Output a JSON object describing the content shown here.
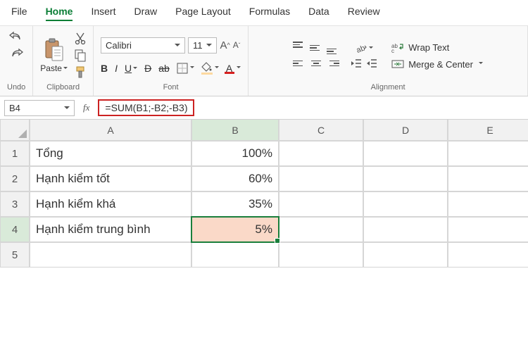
{
  "menu": {
    "file": "File",
    "home": "Home",
    "insert": "Insert",
    "draw": "Draw",
    "pageLayout": "Page Layout",
    "formulas": "Formulas",
    "data": "Data",
    "review": "Review"
  },
  "ribbon": {
    "undoLabel": "Undo",
    "clipboardLabel": "Clipboard",
    "pasteLabel": "Paste",
    "fontLabel": "Font",
    "fontName": "Calibri",
    "fontSize": "11",
    "alignmentLabel": "Alignment",
    "wrapText": "Wrap Text",
    "mergeCenter": "Merge & Center"
  },
  "nameBox": "B4",
  "formula": "=SUM(B1;-B2;-B3)",
  "columns": [
    "A",
    "B",
    "C",
    "D",
    "E"
  ],
  "rowNums": [
    "1",
    "2",
    "3",
    "4",
    "5"
  ],
  "cells": {
    "A1": "Tổng",
    "B1": "100%",
    "A2": "Hạnh kiểm tốt",
    "B2": "60%",
    "A3": "Hạnh kiểm khá",
    "B3": "35%",
    "A4": "Hạnh kiểm trung bình",
    "B4": "5%"
  },
  "activeCell": "B4"
}
